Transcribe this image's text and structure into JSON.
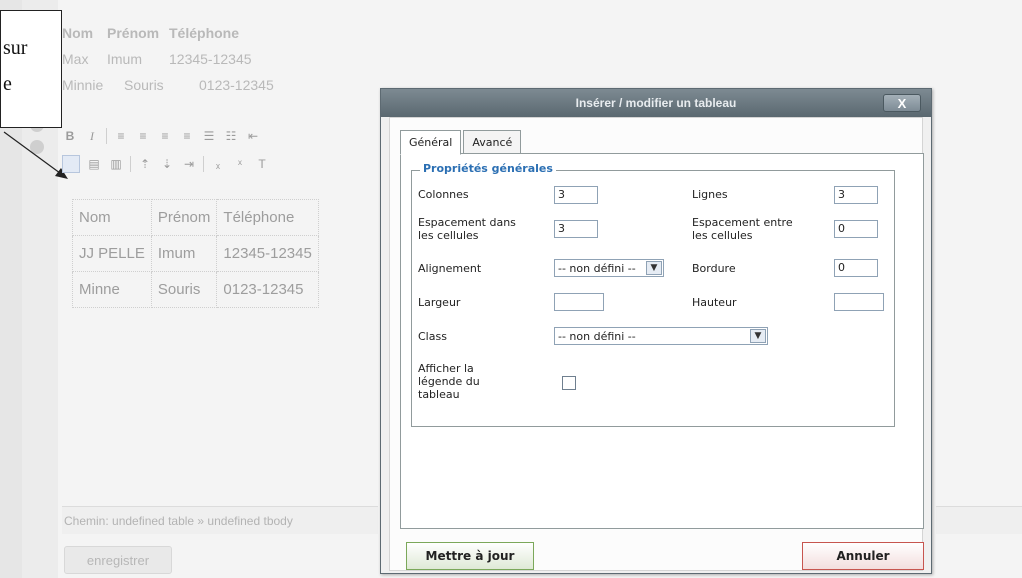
{
  "callout": {
    "line1": "sur",
    "line2": "e"
  },
  "preview": {
    "headers": [
      "Nom",
      "Prénom",
      "Téléphone"
    ],
    "rows": [
      [
        "Max",
        "Imum",
        "12345-12345"
      ],
      [
        "Minnie",
        "Souris",
        "0123-12345"
      ]
    ]
  },
  "editor": {
    "toolbar_bold": "B",
    "toolbar_italic": "I",
    "table": {
      "headers": [
        "Nom",
        "Prénom",
        "Téléphone"
      ],
      "rows": [
        [
          "JJ PELLE",
          "Imum",
          "12345-12345"
        ],
        [
          "Minne",
          "Souris",
          "0123-12345"
        ]
      ]
    },
    "status": "Chemin: undefined table » undefined tbody",
    "save_label": "enregistrer"
  },
  "dialog": {
    "title": "Insérer / modifier un tableau",
    "close_label": "X",
    "tabs": [
      "Général",
      "Avancé"
    ],
    "legend": "Propriétés générales",
    "fields": {
      "colonnes_label": "Colonnes",
      "colonnes_value": "3",
      "lignes_label": "Lignes",
      "lignes_value": "3",
      "espacement_dans_label_1": "Espacement dans",
      "espacement_dans_label_2": "les cellules",
      "espacement_dans_value": "3",
      "espacement_entre_label_1": "Espacement entre",
      "espacement_entre_label_2": "les cellules",
      "espacement_entre_value": "0",
      "alignement_label": "Alignement",
      "alignement_value": "-- non défini --",
      "bordure_label": "Bordure",
      "bordure_value": "0",
      "largeur_label": "Largeur",
      "largeur_value": "",
      "hauteur_label": "Hauteur",
      "hauteur_value": "",
      "class_label": "Class",
      "class_value": "-- non défini --",
      "legende_label_1": "Afficher la",
      "legende_label_2": "légende du",
      "legende_label_3": "tableau",
      "legende_checked": false
    },
    "update_label": "Mettre à jour",
    "cancel_label": "Annuler"
  },
  "colors": {
    "legend": "#2b6fb3",
    "title_bar": "#5a6870",
    "update_border": "#7ba85a",
    "cancel_border": "#c7554f"
  }
}
